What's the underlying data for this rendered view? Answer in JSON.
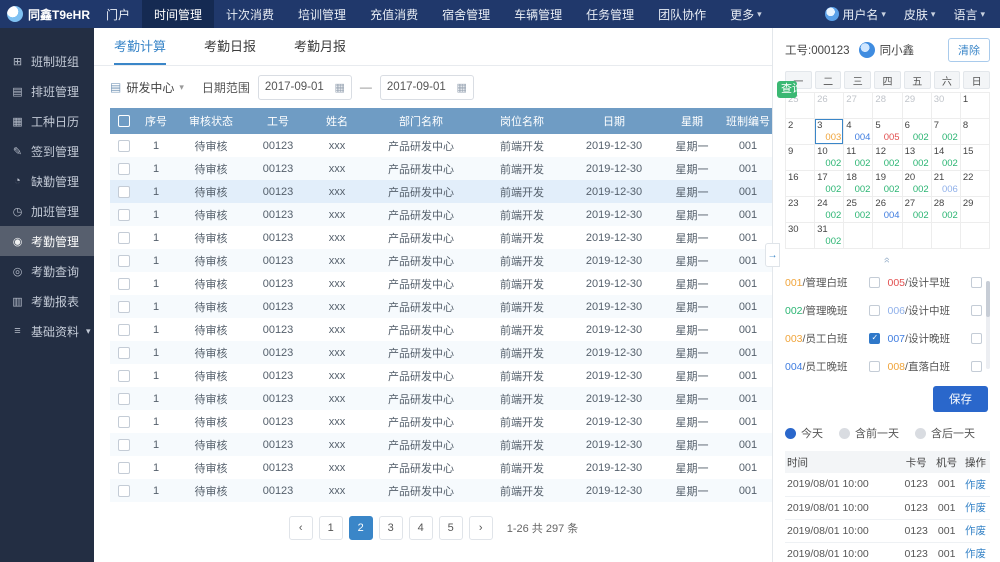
{
  "navbar": {
    "logo_text": "同鑫T9eHR",
    "items": [
      {
        "label": "门户"
      },
      {
        "label": "时间管理",
        "active": true
      },
      {
        "label": "计次消费"
      },
      {
        "label": "培训管理"
      },
      {
        "label": "充值消费"
      },
      {
        "label": "宿舍管理"
      },
      {
        "label": "车辆管理"
      },
      {
        "label": "任务管理"
      },
      {
        "label": "团队协作"
      },
      {
        "label": "更多",
        "caret": true
      }
    ],
    "right_items": [
      {
        "label": "用户名",
        "avatar": true,
        "caret": true
      },
      {
        "label": "皮肤",
        "caret": true
      },
      {
        "label": "语言",
        "caret": true
      }
    ]
  },
  "sidebar": {
    "items": [
      {
        "label": "班制班组",
        "icon": "grid-icon"
      },
      {
        "label": "排班管理",
        "icon": "rows-icon"
      },
      {
        "label": "工种日历",
        "icon": "calendar-icon"
      },
      {
        "label": "签到管理",
        "icon": "pen-icon"
      },
      {
        "label": "缺勤管理",
        "icon": "clock-icon"
      },
      {
        "label": "加班管理",
        "icon": "overtime-icon"
      },
      {
        "label": "考勤管理",
        "icon": "target-icon",
        "active": true
      },
      {
        "label": "考勤查询",
        "icon": "search-icon"
      },
      {
        "label": "考勤报表",
        "icon": "report-icon"
      },
      {
        "label": "基础资料",
        "icon": "menu-icon",
        "caret": true
      }
    ]
  },
  "tabs": [
    {
      "label": "考勤计算",
      "active": true
    },
    {
      "label": "考勤日报"
    },
    {
      "label": "考勤月报"
    }
  ],
  "filters": {
    "dept": "研发中心",
    "date_label": "日期范围",
    "date_from": "2017-09-01",
    "date_to": "2017-09-01",
    "search_label": "查询"
  },
  "table": {
    "headers": [
      "序号",
      "审核状态",
      "工号",
      "姓名",
      "部门名称",
      "岗位名称",
      "日期",
      "星期",
      "班制编号"
    ],
    "highlighted_row_index": 2,
    "rows": [
      [
        "1",
        "待审核",
        "00123",
        "xxx",
        "产品研发中心",
        "前端开发",
        "2019-12-30",
        "星期一",
        "001"
      ],
      [
        "1",
        "待审核",
        "00123",
        "xxx",
        "产品研发中心",
        "前端开发",
        "2019-12-30",
        "星期一",
        "001"
      ],
      [
        "1",
        "待审核",
        "00123",
        "xxx",
        "产品研发中心",
        "前端开发",
        "2019-12-30",
        "星期一",
        "001"
      ],
      [
        "1",
        "待审核",
        "00123",
        "xxx",
        "产品研发中心",
        "前端开发",
        "2019-12-30",
        "星期一",
        "001"
      ],
      [
        "1",
        "待审核",
        "00123",
        "xxx",
        "产品研发中心",
        "前端开发",
        "2019-12-30",
        "星期一",
        "001"
      ],
      [
        "1",
        "待审核",
        "00123",
        "xxx",
        "产品研发中心",
        "前端开发",
        "2019-12-30",
        "星期一",
        "001"
      ],
      [
        "1",
        "待审核",
        "00123",
        "xxx",
        "产品研发中心",
        "前端开发",
        "2019-12-30",
        "星期一",
        "001"
      ],
      [
        "1",
        "待审核",
        "00123",
        "xxx",
        "产品研发中心",
        "前端开发",
        "2019-12-30",
        "星期一",
        "001"
      ],
      [
        "1",
        "待审核",
        "00123",
        "xxx",
        "产品研发中心",
        "前端开发",
        "2019-12-30",
        "星期一",
        "001"
      ],
      [
        "1",
        "待审核",
        "00123",
        "xxx",
        "产品研发中心",
        "前端开发",
        "2019-12-30",
        "星期一",
        "001"
      ],
      [
        "1",
        "待审核",
        "00123",
        "xxx",
        "产品研发中心",
        "前端开发",
        "2019-12-30",
        "星期一",
        "001"
      ],
      [
        "1",
        "待审核",
        "00123",
        "xxx",
        "产品研发中心",
        "前端开发",
        "2019-12-30",
        "星期一",
        "001"
      ],
      [
        "1",
        "待审核",
        "00123",
        "xxx",
        "产品研发中心",
        "前端开发",
        "2019-12-30",
        "星期一",
        "001"
      ],
      [
        "1",
        "待审核",
        "00123",
        "xxx",
        "产品研发中心",
        "前端开发",
        "2019-12-30",
        "星期一",
        "001"
      ],
      [
        "1",
        "待审核",
        "00123",
        "xxx",
        "产品研发中心",
        "前端开发",
        "2019-12-30",
        "星期一",
        "001"
      ],
      [
        "1",
        "待审核",
        "00123",
        "xxx",
        "产品研发中心",
        "前端开发",
        "2019-12-30",
        "星期一",
        "001"
      ]
    ]
  },
  "pagination": {
    "prev_label": "‹",
    "next_label": "›",
    "pages": [
      "1",
      "2",
      "3",
      "4",
      "5"
    ],
    "active": "2",
    "summary": "1-26 共 297 条"
  },
  "panel": {
    "emp_no_label": "工号:000123",
    "emp_name": "同小鑫",
    "clear_label": "清除",
    "weekdays": [
      "一",
      "二",
      "三",
      "四",
      "五",
      "六",
      "日"
    ],
    "calendar": [
      {
        "d": "25",
        "o": true
      },
      {
        "d": "26",
        "o": true
      },
      {
        "d": "27",
        "o": true
      },
      {
        "d": "28",
        "o": true
      },
      {
        "d": "29",
        "o": true
      },
      {
        "d": "30",
        "o": true
      },
      {
        "d": "1"
      },
      {
        "d": "2"
      },
      {
        "d": "3",
        "v": "003",
        "c": "orange",
        "s": true
      },
      {
        "d": "4",
        "v": "004",
        "c": "blue"
      },
      {
        "d": "5",
        "v": "005",
        "c": "red"
      },
      {
        "d": "6",
        "v": "002",
        "c": "green"
      },
      {
        "d": "7",
        "v": "002",
        "c": "green"
      },
      {
        "d": "8"
      },
      {
        "d": "9"
      },
      {
        "d": "10",
        "v": "002",
        "c": "green"
      },
      {
        "d": "11",
        "v": "002",
        "c": "green"
      },
      {
        "d": "12",
        "v": "002",
        "c": "green"
      },
      {
        "d": "13",
        "v": "002",
        "c": "green"
      },
      {
        "d": "14",
        "v": "002",
        "c": "green"
      },
      {
        "d": "15"
      },
      {
        "d": "16"
      },
      {
        "d": "17",
        "v": "002",
        "c": "green"
      },
      {
        "d": "18",
        "v": "002",
        "c": "green"
      },
      {
        "d": "19",
        "v": "002",
        "c": "green"
      },
      {
        "d": "20",
        "v": "002",
        "c": "green"
      },
      {
        "d": "21",
        "v": "006",
        "c": "lightblue"
      },
      {
        "d": "22"
      },
      {
        "d": "23"
      },
      {
        "d": "24",
        "v": "002",
        "c": "green"
      },
      {
        "d": "25",
        "v": "002",
        "c": "green"
      },
      {
        "d": "26",
        "v": "004",
        "c": "blue"
      },
      {
        "d": "27",
        "v": "002",
        "c": "green"
      },
      {
        "d": "28",
        "v": "002",
        "c": "green"
      },
      {
        "d": "29"
      },
      {
        "d": "30"
      },
      {
        "d": "31",
        "v": "002",
        "c": "green"
      },
      {
        "d": ""
      },
      {
        "d": ""
      },
      {
        "d": ""
      },
      {
        "d": ""
      },
      {
        "d": ""
      }
    ],
    "shifts": [
      {
        "code": "001",
        "name": "管理白班",
        "color": "orange",
        "checked": false
      },
      {
        "code": "005",
        "name": "设计早班",
        "color": "red",
        "checked": false
      },
      {
        "code": "002",
        "name": "管理晚班",
        "color": "green",
        "checked": false
      },
      {
        "code": "006",
        "name": "设计中班",
        "color": "lightblue",
        "checked": false
      },
      {
        "code": "003",
        "name": "员工白班",
        "color": "orange",
        "checked": true
      },
      {
        "code": "007",
        "name": "设计晚班",
        "color": "blue",
        "checked": false
      },
      {
        "code": "004",
        "name": "员工晚班",
        "color": "blue",
        "checked": false
      },
      {
        "code": "008",
        "name": "直落白班",
        "color": "orange",
        "checked": false
      }
    ],
    "save_label": "保存",
    "radios": [
      {
        "label": "今天",
        "selected": true
      },
      {
        "label": "含前一天",
        "selected": false
      },
      {
        "label": "含后一天",
        "selected": false
      }
    ],
    "punch": {
      "headers": [
        "时间",
        "卡号",
        "机号",
        "操作"
      ],
      "rows": [
        {
          "time": "2019/08/01 10:00",
          "card": "0123",
          "machine": "001",
          "action": "作废"
        },
        {
          "time": "2019/08/01 10:00",
          "card": "0123",
          "machine": "001",
          "action": "作废"
        },
        {
          "time": "2019/08/01 10:00",
          "card": "0123",
          "machine": "001",
          "action": "作废"
        },
        {
          "time": "2019/08/01 10:00",
          "card": "0123",
          "machine": "001",
          "action": "作废"
        }
      ]
    }
  },
  "colors": {
    "orange": "#f0a43a",
    "green": "#2bb573",
    "blue": "#3f7de0",
    "red": "#e25050",
    "lightblue": "#8fb0ea",
    "accent": "#3a86c8",
    "header_blue": "#6f9cc4",
    "save_blue": "#2a67cb",
    "search_green": "#3bb873"
  }
}
